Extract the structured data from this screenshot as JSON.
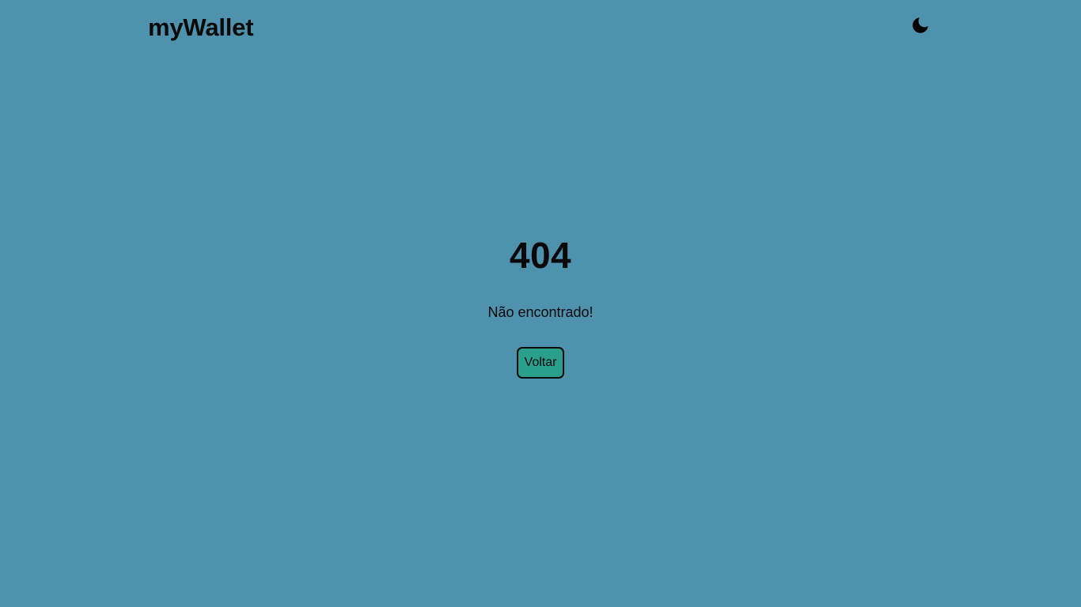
{
  "header": {
    "brand": "myWallet",
    "theme_toggle_icon": "moon-icon"
  },
  "main": {
    "error_code": "404",
    "message": "Não encontrado!",
    "back_button_label": "Voltar"
  },
  "colors": {
    "background": "#4f92ae",
    "button_background": "#2aa08c",
    "text": "#0a0a0a"
  }
}
